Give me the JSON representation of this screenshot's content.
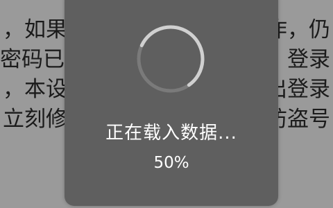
{
  "background": {
    "lines": [
      {
        "left": "，如果",
        "right": "作，仍"
      },
      {
        "left": "密码已",
        "right": "登录"
      },
      {
        "left": "，本设",
        "right": "出登录"
      },
      {
        "left": "立刻修",
        "right": "防盗号"
      }
    ]
  },
  "dialog": {
    "title": "正在载入数据...",
    "percent_text": "50%",
    "progress": 0.5
  },
  "colors": {
    "page_background": "#9a9a9a",
    "dialog_background": "#5f5f5f",
    "text": "#ffffff",
    "spinner_arc": "#d0d0d0",
    "spinner_track": "#7a7a7a"
  },
  "icons": {
    "spinner": "loading-spinner-icon"
  }
}
